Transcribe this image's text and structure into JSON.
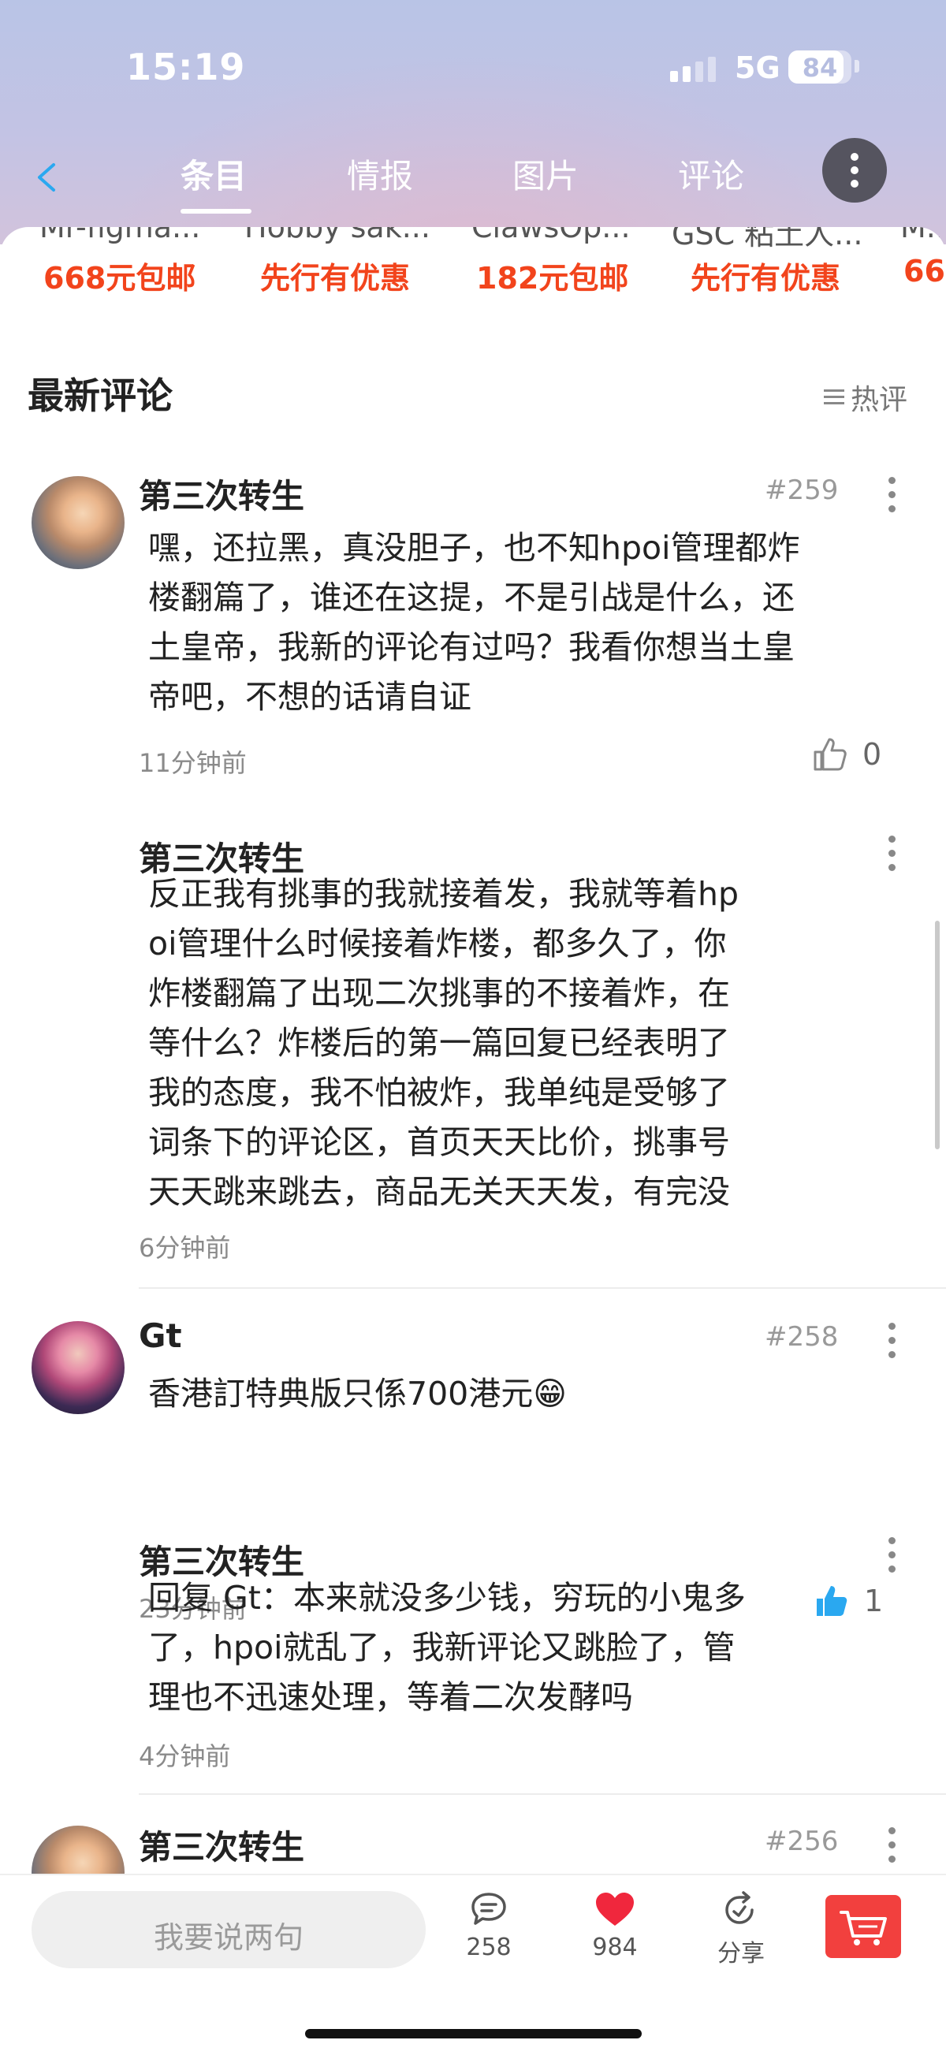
{
  "status_bar": {
    "time": "15:19",
    "network": "5G",
    "battery": "84"
  },
  "nav": {
    "tabs": [
      {
        "label": "条目",
        "active": true
      },
      {
        "label": "情报",
        "active": false
      },
      {
        "label": "图片",
        "active": false
      },
      {
        "label": "评论",
        "active": false
      }
    ]
  },
  "shops": [
    {
      "name": "Mr-figma...",
      "price": "668元包邮"
    },
    {
      "name": "Hobby sak...",
      "price": "先行有优惠"
    },
    {
      "name": "ClawsOp...",
      "price": "182元包邮"
    },
    {
      "name": "GSC 粘土人...",
      "price": "先行有优惠"
    },
    {
      "name": "M...",
      "price": "66"
    }
  ],
  "section": {
    "title": "最新评论",
    "sort_label": "热评"
  },
  "comments": [
    {
      "author": "第三次转生",
      "floor": "#259",
      "lines": [
        "嘿，还拉黑，真没胆子，也不知hpoi管理都炸",
        "楼翻篇了，谁还在这提，不是引战是什么，还",
        "土皇帝，我新的评论有过吗？我看你想当土皇",
        "帝吧，不想的话请自证"
      ],
      "time": "11分钟前",
      "likes": "0",
      "reply": {
        "author": "第三次转生",
        "lines": [
          "反正我有挑事的我就接着发，我就等着hp",
          "oi管理什么时候接着炸楼，都多久了，你",
          "炸楼翻篇了出现二次挑事的不接着炸，在",
          "等什么？炸楼后的第一篇回复已经表明了",
          "我的态度，我不怕被炸，我单纯是受够了",
          "词条下的评论区，首页天天比价，挑事号",
          "天天跳来跳去，商品无关天天发，有完没"
        ],
        "time": "6分钟前"
      }
    },
    {
      "author": "Gt",
      "floor": "#258",
      "lines": [
        "香港訂特典版只係700港元😁"
      ],
      "time": "23分钟前",
      "likes": "1",
      "reply": {
        "author": "第三次转生",
        "lines": [
          "回复 Gt：本来就没多少钱，穷玩的小鬼多",
          "了，hpoi就乱了，我新评论又跳脸了，管",
          "理也不迅速处理，等着二次发酵吗"
        ],
        "time": "4分钟前"
      }
    },
    {
      "author": "第三次转生",
      "floor": "#256"
    }
  ],
  "bottom_bar": {
    "input_placeholder": "我要说两句",
    "comments_count": "258",
    "likes_count": "984",
    "share_label": "分享"
  },
  "colors": {
    "accent_red": "#f2441c",
    "like_blue": "#2aa8f0",
    "heart_red": "#f0273d",
    "cart_red": "#f2403e"
  }
}
